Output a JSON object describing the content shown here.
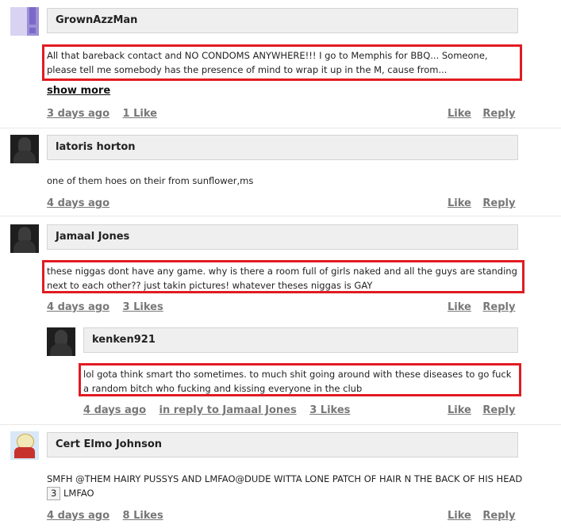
{
  "comments": [
    {
      "username": "GrownAzzMan",
      "text": "All that bareback contact and NO CONDOMS ANYWHERE!!! I go to Memphis for BBQ... Someone, please tell me somebody has the presence of mind to wrap it up in the M, cause from...",
      "show_more": "show more",
      "time": "3 days ago",
      "likes": "1 Like",
      "like": "Like",
      "reply": "Reply"
    },
    {
      "username": "latoris horton",
      "text": "one of them hoes on their from sunflower,ms",
      "time": "4 days ago",
      "like": "Like",
      "reply": "Reply"
    },
    {
      "username": "Jamaal Jones",
      "text": "these niggas dont have any game. why is there a room full of girls naked and all the guys are standing next to each other?? just takin pictures! whatever theses niggas is GAY",
      "time": "4 days ago",
      "likes": "3 Likes",
      "like": "Like",
      "reply": "Reply"
    },
    {
      "username": "kenken921",
      "text": "lol gota think smart tho sometimes. to much shit going around with these diseases to go fuck a random bitch who fucking and kissing everyone in the club",
      "time": "4 days ago",
      "in_reply_to": "in reply to Jamaal Jones",
      "likes": "3 Likes",
      "like": "Like",
      "reply": "Reply"
    },
    {
      "username": "Cert Elmo Johnson",
      "text_before": "SMFH @THEM HAIRY PUSSYS AND LMFAO@DUDE WITTA LONE PATCH OF HAIR N THE BACK OF HIS HEAD",
      "badge": "3",
      "text_after": "LMFAO",
      "time": "4 days ago",
      "likes": "8 Likes",
      "like": "Like",
      "reply": "Reply"
    }
  ],
  "colors": {
    "highlight": "#e11b22",
    "namebox_bg": "#efefef",
    "link": "#777777"
  },
  "icons": {
    "avatar_1": "purple-exclamation-avatar",
    "avatar_2": "silhouette-avatar",
    "avatar_3": "silhouette-avatar",
    "avatar_4": "silhouette-avatar",
    "avatar_5": "cartoon-avatar"
  }
}
